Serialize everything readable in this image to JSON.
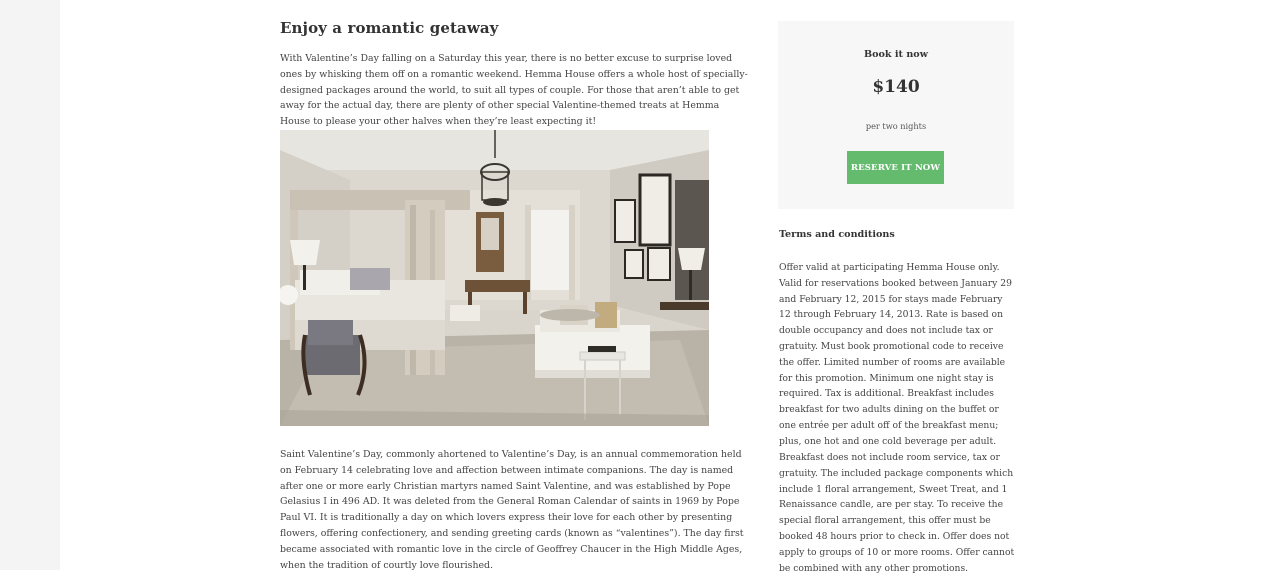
{
  "article": {
    "title": "Enjoy a romantic getaway",
    "intro": "With Valentine’s Day falling on a Saturday this year, there is no better excuse to surprise loved ones by whisking them off on a romantic weekend. Hemma House offers a whole host of specially-designed packages around the world, to suit all types of couple. For those that aren’t able to get away for the actual day, there are plenty of other special Valentine-themed treats at Hemma House to please your other halves when they’re least expecting it!",
    "photo_subject": "bedroom-with-canopy-bed",
    "body": "Saint Valentine’s Day, commonly ahortened to Valentine’s Day, is an annual commemoration held on February 14 celebrating love and affection between intimate companions. The day is named after one or more early Christian martyrs named Saint Valentine, and was established by Pope Gelasius I in 496 AD. It was deleted from the General Roman Calendar of saints in 1969 by Pope Paul VI. It is traditionally a day on which lovers express their love for each other by presenting flowers, offering confectionery, and sending greeting cards (known as “valentines”). The day first became associated with romantic love in the circle of Geoffrey Chaucer in the High Middle Ages, when the tradition of courtly love flourished."
  },
  "booking": {
    "label": "Book it now",
    "price": "$140",
    "price_note": "per two nights",
    "button_label": "RESERVE IT NOW",
    "button_color": "#64bb6e",
    "card_background": "#f7f7f7"
  },
  "terms": {
    "title": "Terms and conditions",
    "paragraph_1": "Offer valid at participating Hemma House only. Valid for reservations booked between January 29 and February 12, 2015 for stays made February 12 through February 14, 2013. Rate is based on double occupancy and does not include tax or gratuity. Must book promotional code to receive the offer. Limited number of rooms are available for this promotion. Minimum one night stay is required. Tax is additional. Breakfast includes breakfast for two adults dining on the buffet or one entrée per adult off of the breakfast menu; plus, one hot and one cold beverage per adult.",
    "paragraph_2": "Breakfast does not include room service, tax or gratuity. The included package components which include 1 floral arrangement, Sweet Treat, and 1 Renaissance candle, are per stay. To receive the special floral arrangement, this offer must be booked 48 hours prior to check in. Offer does not apply to groups of 10 or more rooms. Offer cannot be combined with any other promotions."
  }
}
